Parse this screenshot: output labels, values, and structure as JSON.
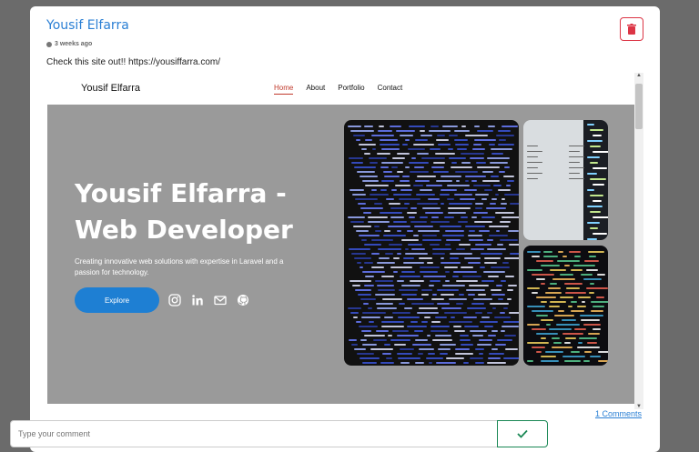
{
  "post": {
    "author": "Yousif Elfarra",
    "time": "3 weeks ago",
    "message": "Check this site out!! https://yousiffarra.com/"
  },
  "preview": {
    "brand": "Yousif Elfarra",
    "nav": [
      "Home",
      "About",
      "Portfolio",
      "Contact"
    ],
    "active_nav": "Home",
    "hero_title": "Yousif Elfarra -\nWeb Developer",
    "hero_subtitle": "Creating innovative web solutions with expertise in Laravel and a passion for technology.",
    "cta_label": "Explore",
    "socials": [
      "instagram-icon",
      "linkedin-icon",
      "mail-icon",
      "github-icon"
    ]
  },
  "comments_link": "1 Comments",
  "comment_form": {
    "placeholder": "Type your comment"
  },
  "colors": {
    "accent": "#2a7fd4",
    "danger": "#dc3545",
    "success": "#198754",
    "hero_bg": "#9a9a9a",
    "cta": "#1e7fd3"
  }
}
